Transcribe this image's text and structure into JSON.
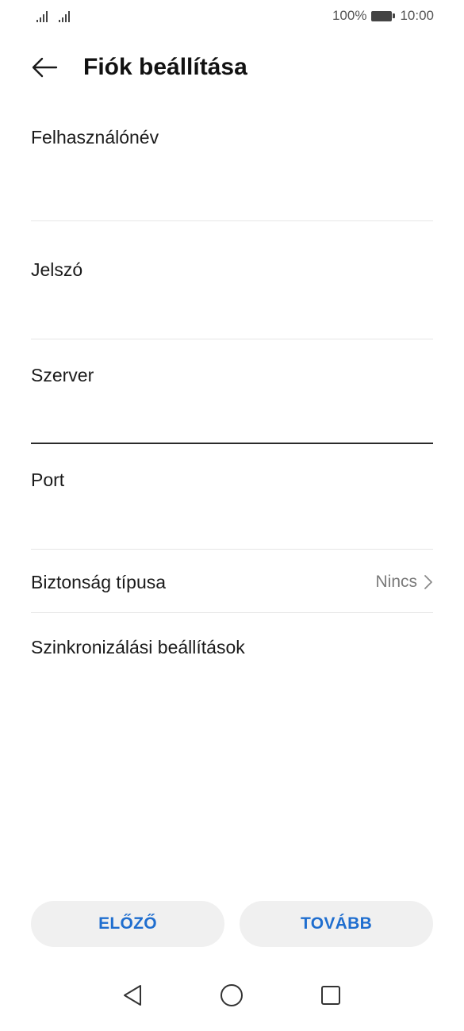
{
  "status_bar": {
    "battery_text": "100%",
    "time": "10:00",
    "battery_level": 1.0
  },
  "header": {
    "title": "Fiók beállítása",
    "back_icon": "arrow-left-icon"
  },
  "form": {
    "username": {
      "label": "Felhasználónév",
      "value": ""
    },
    "password": {
      "label": "Jelszó",
      "value": ""
    },
    "server": {
      "label": "Szerver",
      "value": ""
    },
    "port": {
      "label": "Port",
      "value": ""
    }
  },
  "security": {
    "label": "Biztonság típusa",
    "value": "Nincs",
    "icon": "chevron-right-icon"
  },
  "sync": {
    "label": "Szinkronizálási beállítások"
  },
  "buttons": {
    "previous": "ELŐZŐ",
    "next": "TOVÁBB"
  },
  "colors": {
    "accent": "#1f6ecf",
    "button_bg": "#f0f0f0",
    "divider": "#e6e6e6"
  },
  "nav_bar": {
    "back_icon": "triangle-back-icon",
    "home_icon": "circle-home-icon",
    "recents_icon": "square-recents-icon"
  }
}
